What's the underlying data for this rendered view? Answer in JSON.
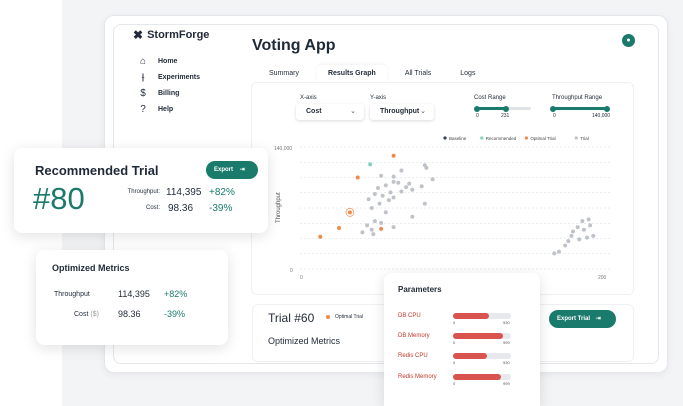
{
  "brand": {
    "name": "StormForge"
  },
  "nav": {
    "items": [
      {
        "label": "Home",
        "icon": "home-icon"
      },
      {
        "label": "Experiments",
        "icon": "experiments-icon"
      },
      {
        "label": "Billing",
        "icon": "dollar-icon"
      },
      {
        "label": "Help",
        "icon": "help-icon"
      }
    ]
  },
  "user": {
    "avatar_icon": "user-icon"
  },
  "app": {
    "title": "Voting App"
  },
  "tabs": [
    {
      "label": "Summary",
      "active": false
    },
    {
      "label": "Results Graph",
      "active": true
    },
    {
      "label": "All Trials",
      "active": false
    },
    {
      "label": "Logs",
      "active": false
    }
  ],
  "controls": {
    "xaxis": {
      "label": "X-axis",
      "value": "Cost"
    },
    "yaxis": {
      "label": "Y-axis",
      "value": "Throughput"
    },
    "cost_range": {
      "label": "Cost Range",
      "min": "0",
      "max": "231"
    },
    "throughput_range": {
      "label": "Throughput Range",
      "min": "0",
      "max": "140,000"
    }
  },
  "chart_data": {
    "type": "scatter",
    "ylabel": "Throughput",
    "y_ticks": [
      "140,000",
      "0"
    ],
    "x_ticks": [
      "0",
      "200"
    ],
    "xlim": [
      0,
      200
    ],
    "ylim": [
      0,
      140000
    ],
    "grid": true,
    "legend": [
      "Baseline",
      "Recommended",
      "Optimal Trial",
      "Trial"
    ],
    "legend_placement": "top-right",
    "colors": {
      "Baseline": "#374151",
      "Recommended": "#7dd3c0",
      "Optimal Trial": "#f08a4b",
      "Trial": "#bfc3c9"
    },
    "series": [
      {
        "name": "Recommended",
        "points": [
          [
            45,
            120000
          ]
        ]
      },
      {
        "name": "Optimal Trial",
        "points": [
          [
            60,
            130000
          ],
          [
            37,
            105000
          ],
          [
            32,
            65000
          ],
          [
            25,
            47000
          ],
          [
            13,
            37000
          ],
          [
            52,
            46000
          ]
        ]
      },
      {
        "name": "Trial",
        "points": [
          [
            52,
            107000
          ],
          [
            60,
            106000
          ],
          [
            65,
            113000
          ],
          [
            60,
            100000
          ],
          [
            63,
            99000
          ],
          [
            70,
            98000
          ],
          [
            55,
            96000
          ],
          [
            50,
            93000
          ],
          [
            58,
            88000
          ],
          [
            65,
            89000
          ],
          [
            72,
            91000
          ],
          [
            68,
            94000
          ],
          [
            48,
            86000
          ],
          [
            53,
            84000
          ],
          [
            60,
            82000
          ],
          [
            57,
            79000
          ],
          [
            44,
            80000
          ],
          [
            51,
            75000
          ],
          [
            46,
            70000
          ],
          [
            55,
            65000
          ],
          [
            48,
            55000
          ],
          [
            52,
            53000
          ],
          [
            43,
            50000
          ],
          [
            46,
            45000
          ],
          [
            40,
            42000
          ],
          [
            47,
            40000
          ],
          [
            60,
            48000
          ],
          [
            78,
            95000
          ],
          [
            80,
            119000
          ],
          [
            81,
            116000
          ],
          [
            85,
            103000
          ],
          [
            80,
            75000
          ],
          [
            72,
            60000
          ],
          [
            181,
            55000
          ],
          [
            185,
            57000
          ],
          [
            186,
            50000
          ],
          [
            178,
            48000
          ],
          [
            182,
            45000
          ],
          [
            175,
            43000
          ],
          [
            174,
            38000
          ],
          [
            179,
            34000
          ],
          [
            172,
            32000
          ],
          [
            170,
            27000
          ],
          [
            166,
            20000
          ],
          [
            163,
            18000
          ],
          [
            184,
            36000
          ],
          [
            188,
            38000
          ]
        ]
      }
    ]
  },
  "recommended_card": {
    "title": "Recommended Trial",
    "export_label": "Export",
    "number": "#80",
    "throughput_label": "Throughput:",
    "throughput_value": "114,395",
    "throughput_delta": "+82%",
    "cost_label": "Cost:",
    "cost_value": "98.36",
    "cost_delta": "-39%"
  },
  "optimized_card": {
    "title": "Optimized Metrics",
    "throughput_label": "Throughput",
    "throughput_value": "114,395",
    "throughput_delta": "+82%",
    "cost_label": "Cost",
    "cost_unit": "($)",
    "cost_value": "98.36",
    "cost_delta": "-39%"
  },
  "trial_panel": {
    "title": "Trial #60",
    "badge": "Optimal Trial",
    "subtitle": "Optimized Metrics",
    "export_label": "Export Trial"
  },
  "parameters": {
    "title": "Parameters",
    "items": [
      {
        "label": "DB CPU",
        "min": "0",
        "max": "930",
        "fraction": 0.62
      },
      {
        "label": "DB Memory",
        "min": "0",
        "max": "999",
        "fraction": 0.86
      },
      {
        "label": "Redis CPU",
        "min": "0",
        "max": "930",
        "fraction": 0.58
      },
      {
        "label": "Redis Memory",
        "min": "0",
        "max": "999",
        "fraction": 0.82
      }
    ]
  }
}
